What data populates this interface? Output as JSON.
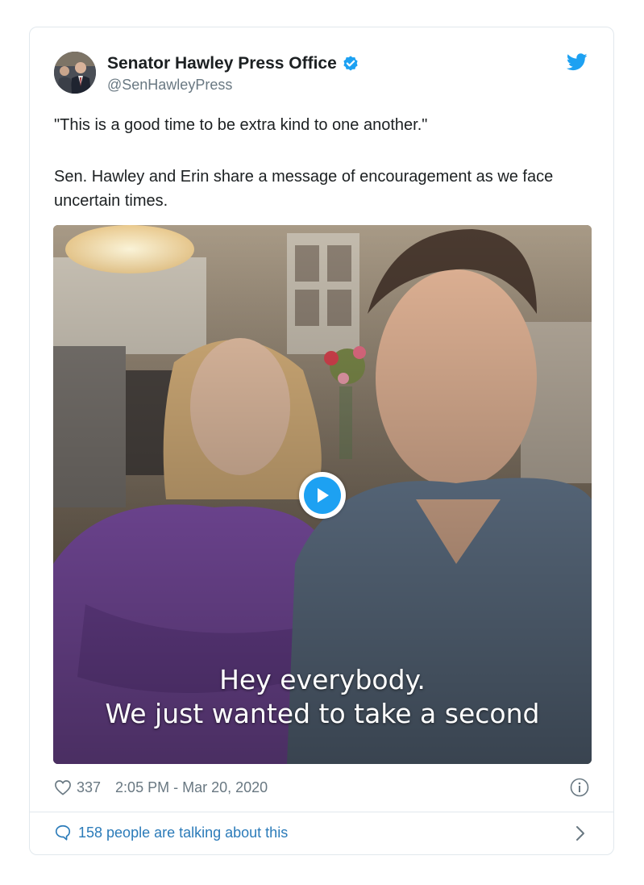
{
  "tweet": {
    "author_name": "Senator Hawley Press Office",
    "author_handle": "@SenHawleyPress",
    "paragraph_1": "\"This is a good time to be extra kind to one another.\"",
    "paragraph_2": "Sen. Hawley and Erin share a message of encouragement as we face uncertain times.",
    "video": {
      "caption_line_1": "Hey everybody.",
      "caption_line_2": "We just wanted to take a second"
    },
    "like_count": "337",
    "timestamp": "2:05 PM - Mar 20, 2020",
    "talking_text": "158 people are talking about this"
  },
  "colors": {
    "brand_blue": "#1da1f2",
    "link_blue": "#2b7bb9",
    "muted_text": "#697882",
    "border": "#e1e8ed"
  },
  "icons": [
    "verified-badge-icon",
    "twitter-bird-icon",
    "play-icon",
    "heart-icon",
    "info-icon",
    "speech-bubble-icon",
    "chevron-right-icon"
  ]
}
